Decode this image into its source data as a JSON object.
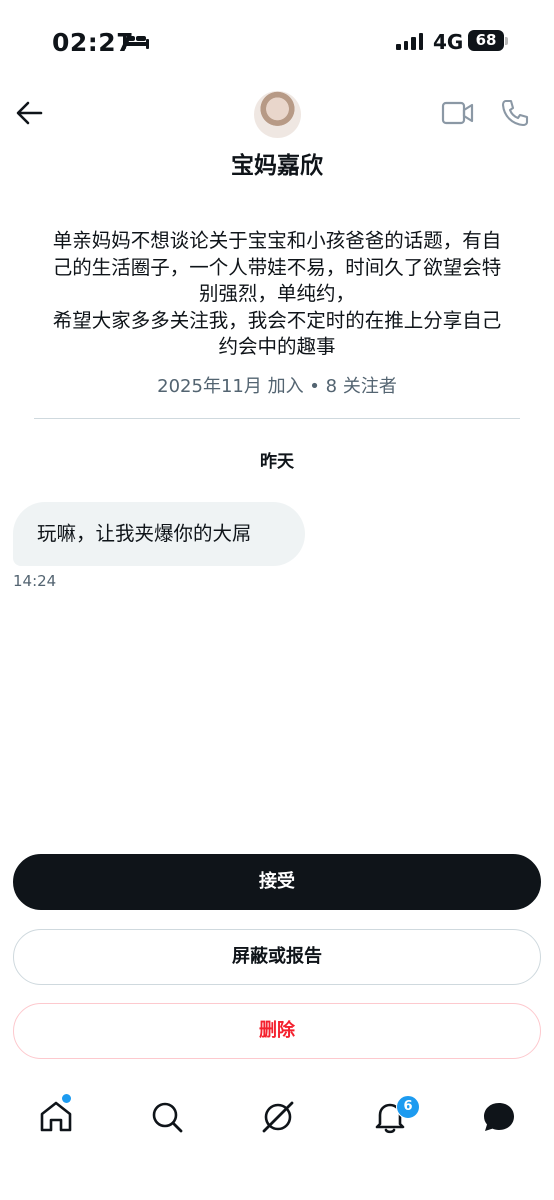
{
  "status_bar": {
    "time": "02:27",
    "network": "4G",
    "battery": "68"
  },
  "header": {
    "profile_name": "宝妈嘉欣",
    "icons": [
      "back-arrow-icon",
      "video-call-icon",
      "phone-call-icon"
    ]
  },
  "profile": {
    "bio": "单亲妈妈不想谈论关于宝宝和小孩爸爸的话题，有自\n己的生活圈子，一个人带娃不易，时间久了欲望会特\n别强烈，单纯约，\n希望大家多多关注我，我会不定时的在推上分享自己\n约会中的趣事",
    "meta": "2025年11月 加入 • 8 关注者"
  },
  "conversation": {
    "date_separator": "昨天",
    "messages": [
      {
        "text": "玩嘛，让我夹爆你的大屌",
        "time": "14:24"
      }
    ]
  },
  "actions": {
    "accept": "接受",
    "block_or_report": "屏蔽或报告",
    "delete": "删除"
  },
  "bottom_nav": {
    "items": [
      "home-icon",
      "search-icon",
      "grok-icon",
      "notifications-icon",
      "messages-icon"
    ],
    "notifications_badge": "6"
  },
  "colors": {
    "primary_text": "#0f1419",
    "secondary_text": "#536471",
    "accent_blue": "#1d9bf0",
    "danger_red": "#f4212e",
    "bubble_bg": "#eff3f4"
  }
}
